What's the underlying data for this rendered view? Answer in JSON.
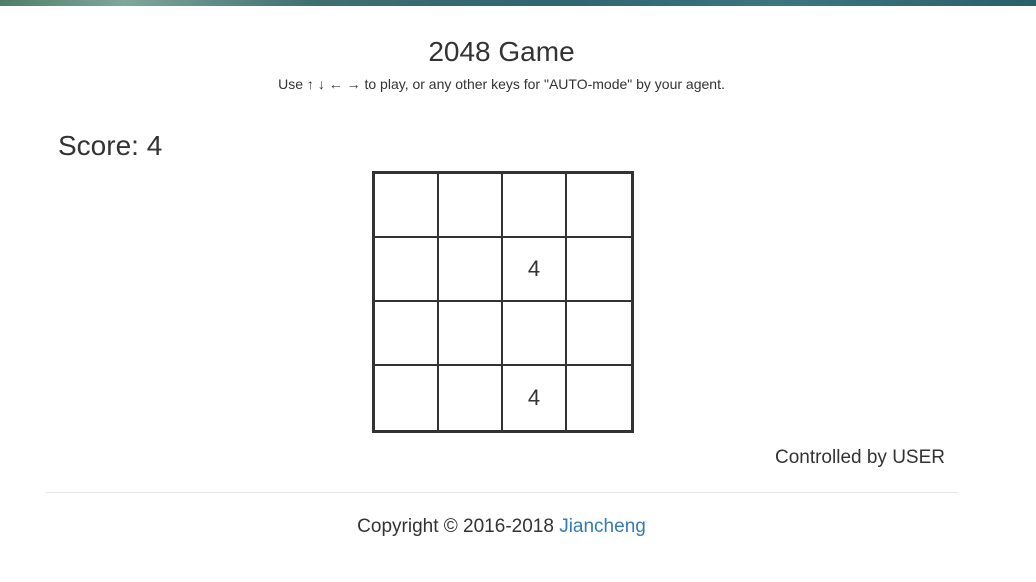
{
  "header": {
    "title": "2048 Game",
    "instructions": "Use ↑ ↓ ← → to play, or any other keys for \"AUTO-mode\" by your agent."
  },
  "score": {
    "text": "Score: 4",
    "value": 4
  },
  "board": {
    "rows": [
      [
        "",
        "",
        "",
        ""
      ],
      [
        "",
        "",
        "4",
        ""
      ],
      [
        "",
        "",
        "",
        ""
      ],
      [
        "",
        "",
        "4",
        ""
      ]
    ]
  },
  "status": {
    "controller_text": "Controlled by USER"
  },
  "footer": {
    "copyright_text": "Copyright © 2016-2018",
    "author_link": "Jiancheng"
  },
  "colors": {
    "text": "#333333",
    "link": "#337ab7",
    "grid": "#333333"
  }
}
